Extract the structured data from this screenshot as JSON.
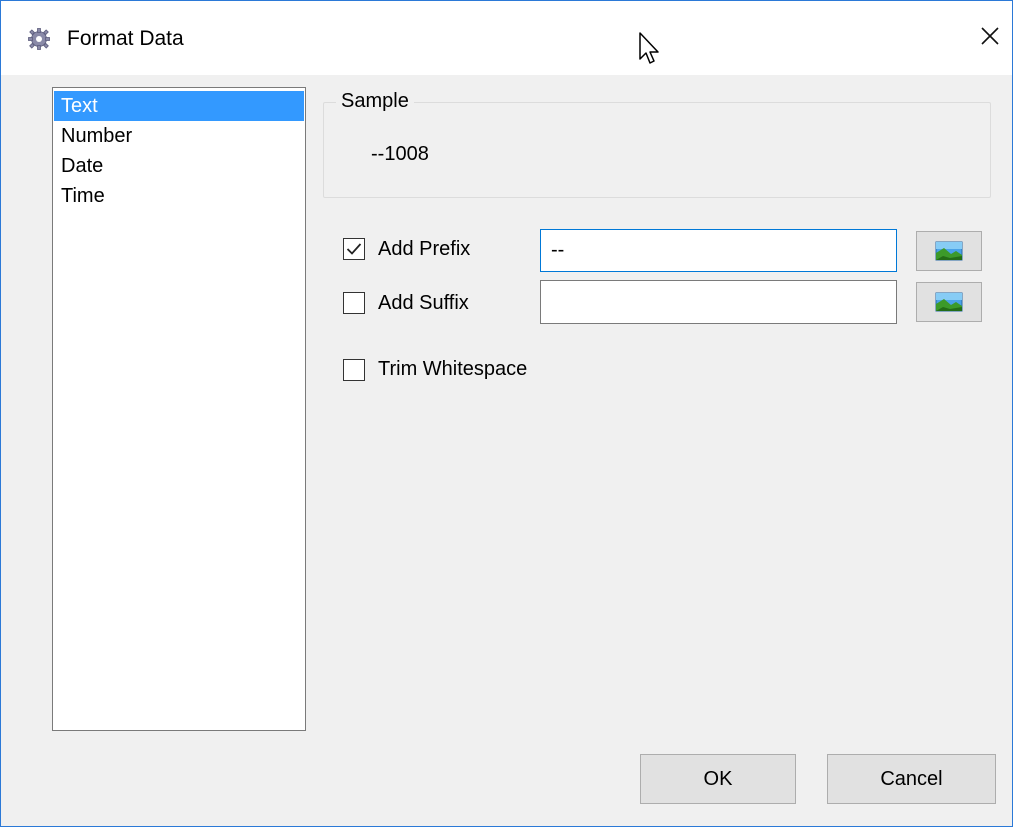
{
  "window": {
    "title": "Format Data",
    "border_color": "#2b79d7"
  },
  "format_list": {
    "items": [
      "Text",
      "Number",
      "Date",
      "Time"
    ],
    "selected": "Text",
    "selection_color": "#3399ff"
  },
  "sample": {
    "label": "Sample",
    "value": "--1008"
  },
  "options": {
    "add_prefix": {
      "label": "Add Prefix",
      "checked": true,
      "value": "--"
    },
    "add_suffix": {
      "label": "Add Suffix",
      "checked": false,
      "value": ""
    },
    "trim_whitespace": {
      "label": "Trim Whitespace",
      "checked": false
    }
  },
  "buttons": {
    "ok": "OK",
    "cancel": "Cancel"
  },
  "icons": {
    "title": "gear-icon",
    "close": "close-icon",
    "prefix_picker": "image-icon",
    "suffix_picker": "image-icon"
  }
}
